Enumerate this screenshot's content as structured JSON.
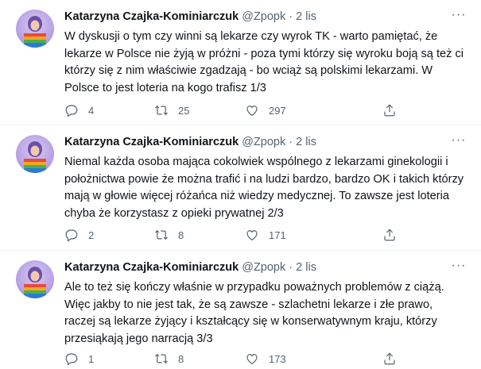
{
  "tweets": [
    {
      "name": "Katarzyna Czajka-Kominiarczuk",
      "handle": "@Zpopk",
      "dot": "·",
      "time": "2 lis",
      "text": "W dyskusji o tym czy winni są lekarze czy wyrok TK - warto pamiętać, że lekarze w Polsce nie żyją w próżni - poza tymi którzy się wyroku boją są też ci którzy się z nim właściwie zgadzają - bo wciąż są polskimi lekarzami. W Polsce to jest loteria na kogo trafisz 1/3",
      "replies": "4",
      "retweets": "25",
      "likes": "297"
    },
    {
      "name": "Katarzyna Czajka-Kominiarczuk",
      "handle": "@Zpopk",
      "dot": "·",
      "time": "2 lis",
      "text": "Niemal każda osoba mająca cokolwiek wspólnego z lekarzami ginekologii i położnictwa powie że można trafić i na ludzi bardzo, bardzo OK i takich którzy mają w głowie więcej różańca niż wiedzy medycznej. To zawsze jest loteria chyba że korzystasz z opieki prywatnej 2/3",
      "replies": "2",
      "retweets": "8",
      "likes": "171"
    },
    {
      "name": "Katarzyna Czajka-Kominiarczuk",
      "handle": "@Zpopk",
      "dot": "·",
      "time": "2 lis",
      "text": "Ale to też się kończy właśnie w przypadku poważnych problemów z ciążą. Więc jakby to nie jest tak, że są zawsze - szlachetni lekarze i złe prawo, raczej są lekarze żyjący i kształcący się w konserwatywnym kraju, którzy przesiąkają jego narracją 3/3",
      "replies": "1",
      "retweets": "8",
      "likes": "173"
    }
  ],
  "icons": {
    "more": "more-horizontal-icon",
    "reply": "reply-icon",
    "retweet": "retweet-icon",
    "like": "heart-icon",
    "share": "share-icon"
  },
  "colors": {
    "text": "#0f1419",
    "secondary": "#536471",
    "divider": "#eff3f4"
  }
}
